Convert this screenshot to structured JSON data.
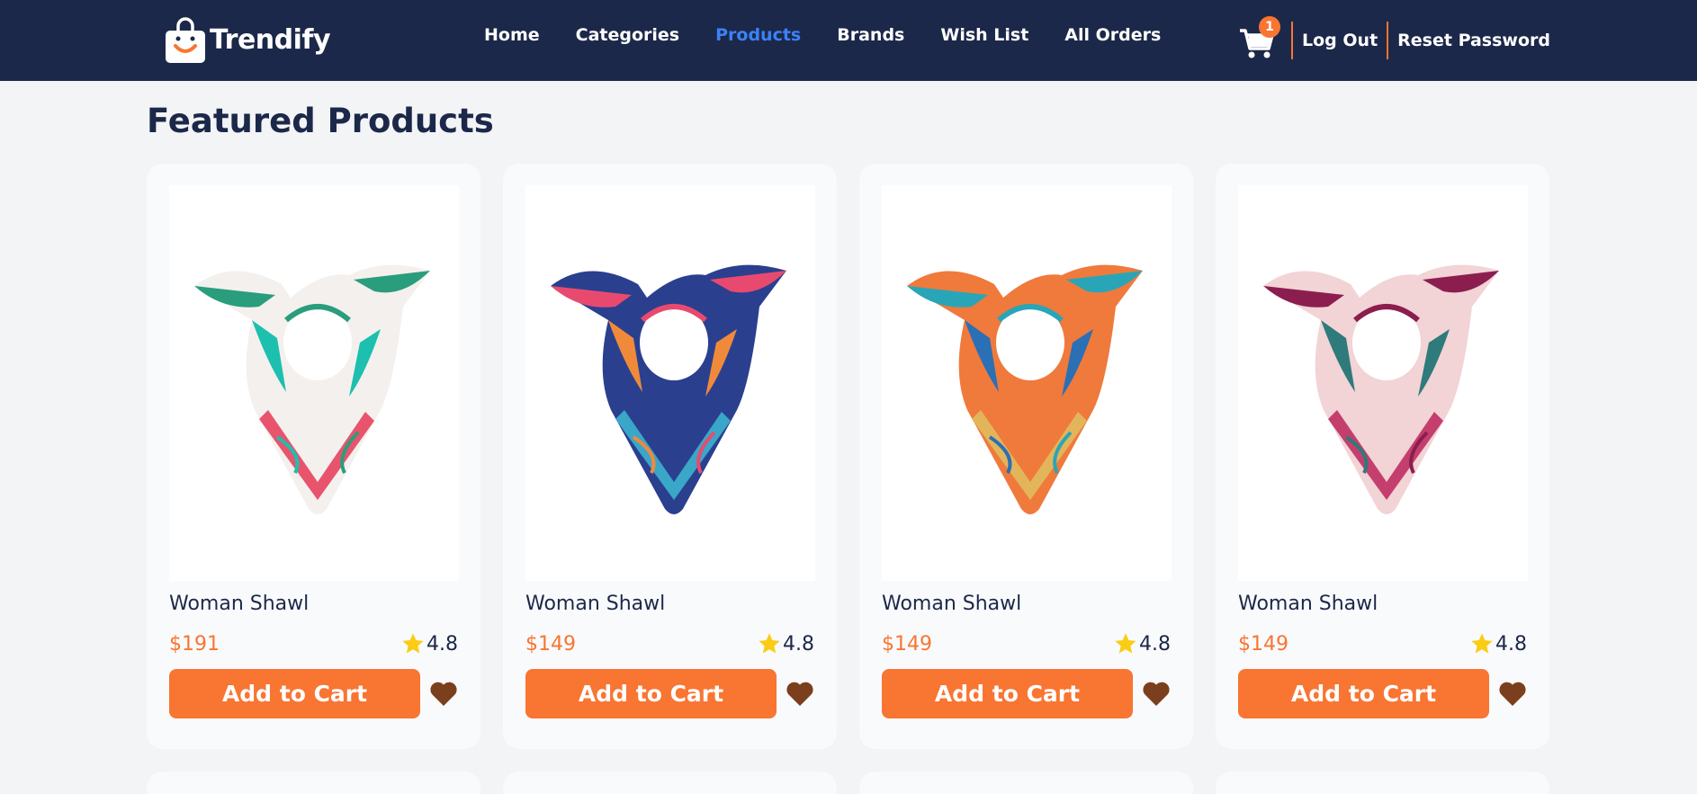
{
  "app": {
    "brand": "Trendify",
    "colors": {
      "navbar": "#1c2849",
      "accent": "#f97532",
      "active_link": "#3b82f6",
      "heart": "#7c3f1d",
      "star": "#facc15"
    }
  },
  "nav": {
    "links": [
      {
        "label": "Home",
        "active": false
      },
      {
        "label": "Categories",
        "active": false
      },
      {
        "label": "Products",
        "active": true
      },
      {
        "label": "Brands",
        "active": false
      },
      {
        "label": "Wish List",
        "active": false
      },
      {
        "label": "All Orders",
        "active": false
      }
    ],
    "cart_count": "1",
    "logout_label": "Log Out",
    "reset_label": "Reset Password"
  },
  "main": {
    "title": "Featured Products",
    "products": [
      {
        "name": "Woman Shawl",
        "price": "$191",
        "rating": "4.8",
        "add_label": "Add to Cart",
        "palette": [
          "#f4f0ee",
          "#2a9d7c",
          "#1dbfae",
          "#e8546c"
        ]
      },
      {
        "name": "Woman Shawl",
        "price": "$149",
        "rating": "4.8",
        "add_label": "Add to Cart",
        "palette": [
          "#2b3f8f",
          "#e84a6f",
          "#f08a3a",
          "#3aa6c8"
        ]
      },
      {
        "name": "Woman Shawl",
        "price": "$149",
        "rating": "4.8",
        "add_label": "Add to Cart",
        "palette": [
          "#ef7a3c",
          "#2aa5b8",
          "#2b6fb5",
          "#e3b55a"
        ]
      },
      {
        "name": "Woman Shawl",
        "price": "$149",
        "rating": "4.8",
        "add_label": "Add to Cart",
        "palette": [
          "#f2d3d6",
          "#8b1e4f",
          "#2f7a7a",
          "#c43f6d"
        ]
      }
    ]
  }
}
